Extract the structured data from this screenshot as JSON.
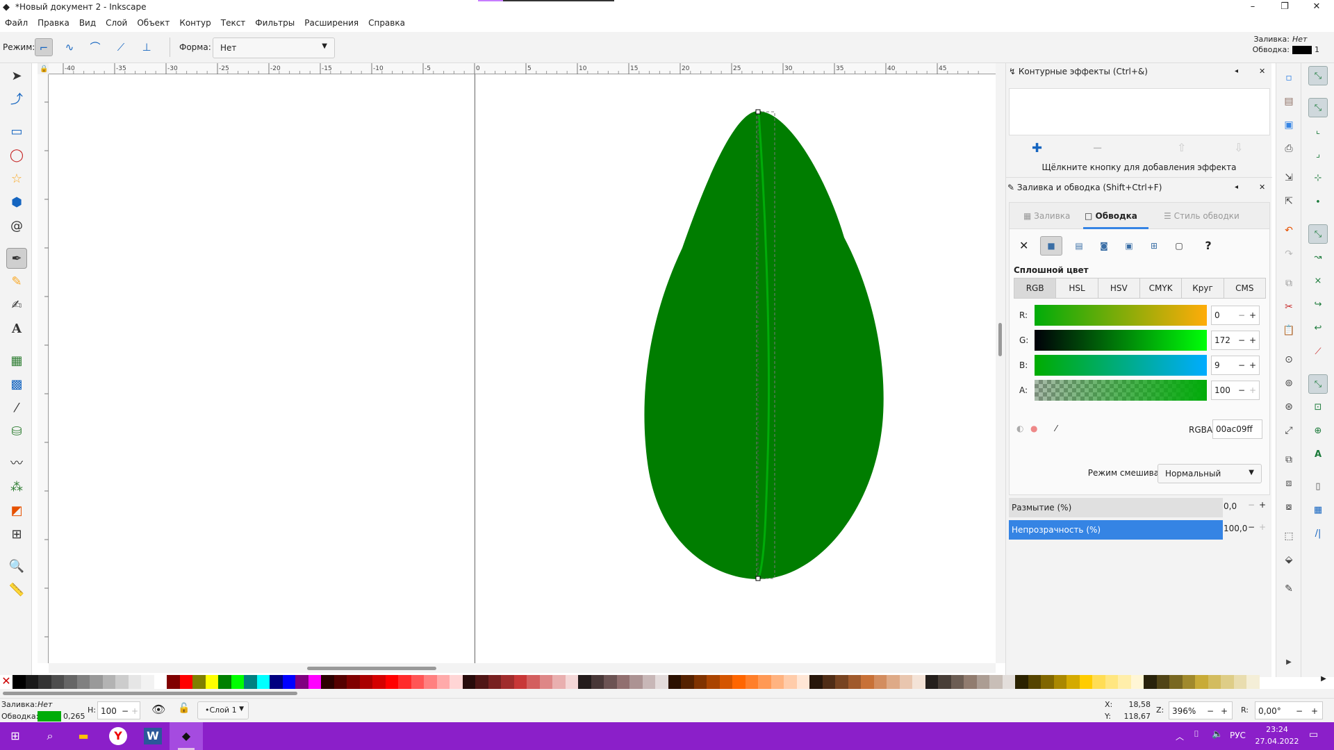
{
  "window": {
    "title": "*Новый документ 2 - Inkscape",
    "minimize": "–",
    "maximize": "❐",
    "close": "✕"
  },
  "menu": [
    "Файл",
    "Правка",
    "Вид",
    "Слой",
    "Объект",
    "Контур",
    "Текст",
    "Фильтры",
    "Расширения",
    "Справка"
  ],
  "toolctrl": {
    "mode_label": "Режим:",
    "shape_label": "Форма:",
    "shape_value": "Нет"
  },
  "style_indicator": {
    "fill_label": "Заливка:",
    "fill_value": "Нет",
    "stroke_label": "Обводка:",
    "stroke_width": "1"
  },
  "ruler_top": [
    "-40",
    "-35",
    "-30",
    "-25",
    "-20",
    "-15",
    "-10",
    "-5",
    "0",
    "5",
    "10",
    "15",
    "20",
    "25",
    "30",
    "35",
    "40",
    "45"
  ],
  "lpe_panel": {
    "title": "Контурные эффекты (Ctrl+&)",
    "hint": "Щёлкните кнопку для добавления эффекта"
  },
  "fill_panel": {
    "title": "Заливка и обводка (Shift+Ctrl+F)",
    "tabs": [
      "Заливка",
      "Обводка",
      "Стиль обводки"
    ],
    "active_tab": "Обводка",
    "paint_label": "Сплошной цвет",
    "modes": [
      "RGB",
      "HSL",
      "HSV",
      "CMYK",
      "Круг",
      "CMS"
    ],
    "channels": [
      {
        "label": "R:",
        "value": "0"
      },
      {
        "label": "G:",
        "value": "172"
      },
      {
        "label": "B:",
        "value": "9"
      },
      {
        "label": "A:",
        "value": "100"
      }
    ],
    "rgba_label": "RGBA:",
    "rgba_value": "00ac09ff",
    "blend_label": "Режим смешивания:",
    "blend_value": "Нормальный",
    "blur_label": "Размытие (%)",
    "blur_value": "0,0",
    "opacity_label": "Непрозрачность (%)",
    "opacity_value": "100,0"
  },
  "status": {
    "fill_label": "Заливка:",
    "fill_value": "Нет",
    "stroke_label": "Обводка:",
    "stroke_width": "0,265",
    "h_label": "Н:",
    "h_value": "100",
    "layer": "•Слой 1",
    "x_label": "X:",
    "x_value": "18,58",
    "y_label": "Y:",
    "y_value": "118,67",
    "zoom_label": "Z:",
    "zoom_value": "396%",
    "rot_label": "R:",
    "rot_value": "0,00°"
  },
  "taskbar": {
    "lang": "РУС",
    "time": "23:24",
    "date": "27.04.2022"
  },
  "colors": {
    "leaf": "#007d00",
    "stroke": "#00ac09",
    "accent": "#3584e4",
    "taskbar": "#8b1fc9"
  },
  "palette": [
    "#000000",
    "#1a1a1a",
    "#333333",
    "#4d4d4d",
    "#666666",
    "#808080",
    "#999999",
    "#b3b3b3",
    "#cccccc",
    "#e6e6e6",
    "#f2f2f2",
    "#ffffff",
    "#800000",
    "#ff0000",
    "#808000",
    "#ffff00",
    "#008000",
    "#00ff00",
    "#008080",
    "#00ffff",
    "#000080",
    "#0000ff",
    "#800080",
    "#ff00ff",
    "#2b0000",
    "#550000",
    "#800000",
    "#aa0000",
    "#d40000",
    "#ff0000",
    "#ff2a2a",
    "#ff5555",
    "#ff8080",
    "#ffaaaa",
    "#ffd5d5",
    "#280b0b",
    "#501616",
    "#782121",
    "#a02c2c",
    "#c83737",
    "#d35f5f",
    "#de8787",
    "#e9afaf",
    "#f4d7d7",
    "#241c1c",
    "#483737",
    "#6c5353",
    "#916f6f",
    "#ac9393",
    "#c8b7b7",
    "#e3dbdb",
    "#2b1100",
    "#552200",
    "#803300",
    "#aa4400",
    "#d45500",
    "#ff6600",
    "#ff7f2a",
    "#ff9955",
    "#ffb380",
    "#ffccaa",
    "#ffe6d5",
    "#28170b",
    "#502d16",
    "#784421",
    "#a05a2c",
    "#c87137",
    "#d38d5f",
    "#deaa87",
    "#e9c6af",
    "#f4e3d7",
    "#241f1c",
    "#483e37",
    "#6c5d53",
    "#917c6f",
    "#ac9d93",
    "#c8beb7",
    "#e3dedb",
    "#2b2200",
    "#554400",
    "#806600",
    "#aa8800",
    "#d4aa00",
    "#ffcc00",
    "#ffdd55",
    "#ffe680",
    "#ffeeaa",
    "#fff6d5",
    "#28220b",
    "#504416",
    "#786721",
    "#a0892c",
    "#c8ab37",
    "#d3bc5f",
    "#decd87",
    "#e9ddaf",
    "#f4eed7"
  ]
}
